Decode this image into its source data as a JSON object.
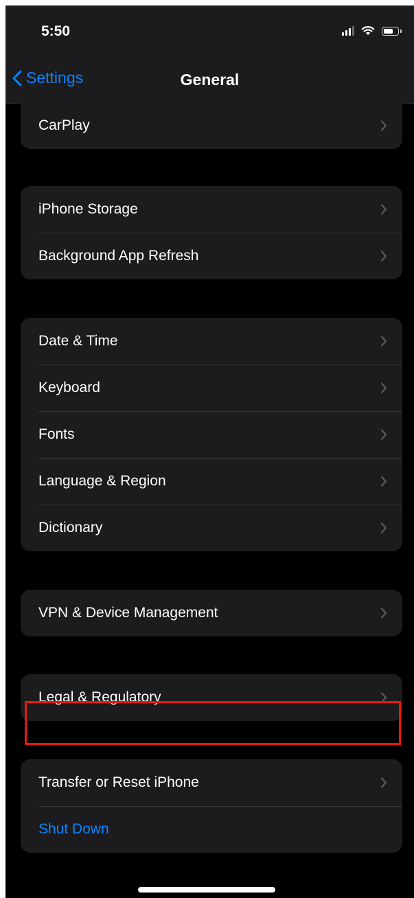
{
  "status": {
    "time": "5:50",
    "signal_icon": "cellular-signal-icon",
    "wifi_icon": "wifi-icon",
    "battery_icon": "battery-icon"
  },
  "nav": {
    "back_label": "Settings",
    "title": "General"
  },
  "groups": {
    "g0": [
      "CarPlay"
    ],
    "g1": [
      "iPhone Storage",
      "Background App Refresh"
    ],
    "g2": [
      "Date & Time",
      "Keyboard",
      "Fonts",
      "Language & Region",
      "Dictionary"
    ],
    "g3": [
      "VPN & Device Management"
    ],
    "g4": [
      "Legal & Regulatory"
    ],
    "g5": [
      "Transfer or Reset iPhone",
      "Shut Down"
    ]
  },
  "colors": {
    "accent": "#0a84ff",
    "background": "#000000",
    "cell": "#1c1c1e",
    "highlight": "#e8190c"
  }
}
